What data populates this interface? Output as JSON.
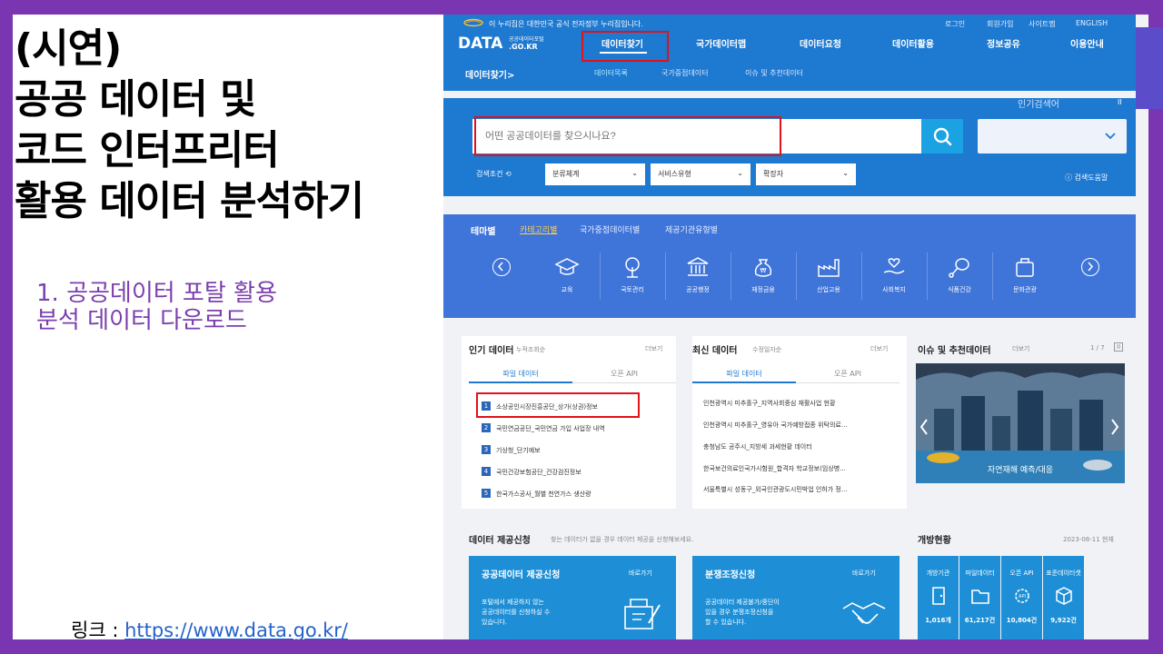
{
  "slide": {
    "title_lines": [
      "(시연)",
      "공공 데이터 및",
      "코드 인터프리터",
      "활용 데이터 분석하기"
    ],
    "subtitle_lines": [
      "1. 공공데이터 포탈 활용",
      "분석 데이터 다운로드"
    ],
    "link_label": "링크 : ",
    "link_url": "https://www.data.go.kr/"
  },
  "site": {
    "gov_notice": "이 누리집은 대한민국 공식 전자정부 누리집입니다.",
    "util": [
      "로그인",
      "회원가입",
      "사이트맵",
      "ENGLISH"
    ],
    "logo": "DATA",
    "logo_sub_1": "공공데이터포털",
    "logo_sub_2": ".GO.KR",
    "nav": [
      "데이터찾기",
      "국가데이터맵",
      "데이터요청",
      "데이터활용",
      "정보공유",
      "이용안내"
    ],
    "subnav_title": "데이터찾기>",
    "subnav": [
      "데이터목록",
      "국가중점데이터",
      "이슈 및 추천데이터"
    ],
    "search_placeholder": "어떤 공공데이터를 찾으시나요?",
    "popular_label": "인기검색어",
    "search_cond": "검색조건",
    "filters": [
      "분류체계",
      "서비스유형",
      "확장자"
    ],
    "search_help": "검색도움말",
    "theme_tabs": [
      "테마별",
      "카테고리별",
      "국가중점데이터별",
      "제공기관유형별"
    ],
    "categories": [
      "교육",
      "국토관리",
      "공공행정",
      "재정금융",
      "산업고용",
      "사회복지",
      "식품건강",
      "문화관광"
    ],
    "popular_data": {
      "title": "인기 데이터",
      "sub": "누적조회순",
      "more": "더보기",
      "tabs": [
        "파일 데이터",
        "오픈 API"
      ],
      "items": [
        "소상공인시장진흥공단_상가(상권)정보",
        "국민연금공단_국민연금 가입 사업장 내역",
        "기상청_단기예보",
        "국민건강보험공단_건강검진정보",
        "한국가스공사_월별 천연가스 생산량"
      ]
    },
    "recent_data": {
      "title": "최신 데이터",
      "sub": "수정일자순",
      "more": "더보기",
      "tabs": [
        "파일 데이터",
        "오픈 API"
      ],
      "items": [
        "인천광역시 미추홀구_지역사회중심 재활사업 현황",
        "인천광역시 미추홀구_영유아 국가예방접종 위탁의료...",
        "충청남도 공주시_지방세 과세현황 데이터",
        "한국보건의료인국가시험원_합격자 학교정보(임상병...",
        "서울특별시 성동구_외국인관광도시민박업 인허가 정..."
      ]
    },
    "issue": {
      "title": "이슈 및 추천데이터",
      "more": "더보기",
      "page": "1 / 7",
      "caption": "자연재해 예측/대응"
    },
    "provide": {
      "title": "데이터 제공신청",
      "desc": "찾는 데이터가 없을 경우 데이터 제공을 신청해보세요."
    },
    "open_status": {
      "title": "개방현황",
      "date": "2023-08-11 현재",
      "stats": [
        {
          "label": "개방기관",
          "value": "1,016개"
        },
        {
          "label": "파일데이터",
          "value": "61,217건"
        },
        {
          "label": "오픈 API",
          "value": "10,804건"
        },
        {
          "label": "표준데이터셋",
          "value": "9,922건"
        }
      ]
    },
    "card1": {
      "title": "공공데이터 제공신청",
      "go": "바로가기",
      "desc": [
        "포털에서 제공하지 않는",
        "공공데이터를 신청하실 수",
        "있습니다."
      ]
    },
    "card2": {
      "title": "분쟁조정신청",
      "go": "바로가기",
      "desc": [
        "공공데이터 제공불가/중단이",
        "있을 경우 분쟁조정신청을",
        "할 수 있습니다."
      ]
    }
  }
}
